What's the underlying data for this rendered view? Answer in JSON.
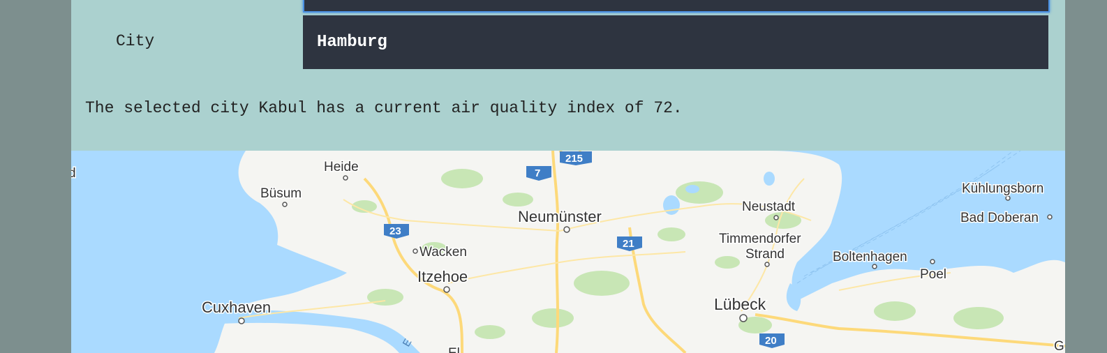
{
  "form": {
    "city_label": "City",
    "city_value": "Hamburg"
  },
  "result_text": "The selected city Kabul has a current air quality index of 72.",
  "map": {
    "places": {
      "edge": "d",
      "heide": "Heide",
      "busum": "Büsum",
      "neumunster": "Neumünster",
      "wacken": "Wacken",
      "itzehoe": "Itzehoe",
      "cuxhaven": "Cuxhaven",
      "neustadt": "Neustadt",
      "timmendorfer": "Timmendorfer",
      "strand": "Strand",
      "boltenhagen": "Boltenhagen",
      "poel": "Poel",
      "kuhlungsborn": "Kühlungsborn",
      "bad_doberan": "Bad Doberan",
      "lubeck": "Lübeck",
      "edge_right": "G",
      "partial_bottom": "El",
      "elbe": "E"
    },
    "roads": {
      "a7": "7",
      "a215": "215",
      "a23": "23",
      "a21": "21",
      "a20": "20"
    },
    "colors": {
      "water": "#aadaff",
      "land": "#f5f5f2",
      "green": "#c8e6b5",
      "road": "#fdd97a",
      "shield": "#3f7ec6"
    }
  }
}
